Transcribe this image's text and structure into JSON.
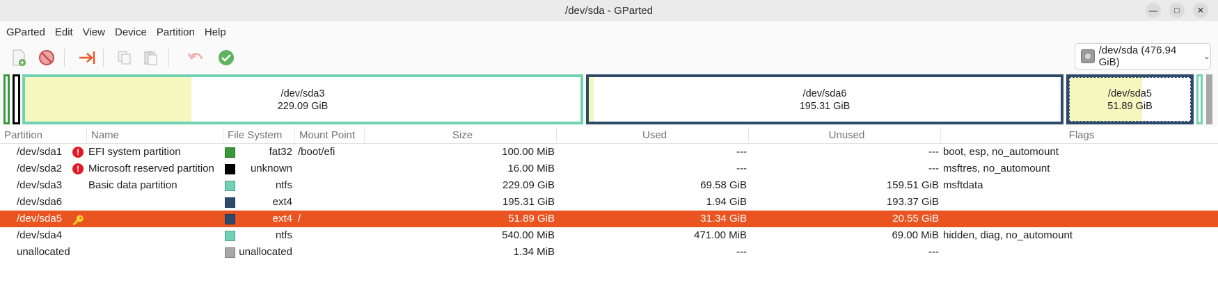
{
  "window": {
    "title": "/dev/sda - GParted"
  },
  "menu": [
    "GParted",
    "Edit",
    "View",
    "Device",
    "Partition",
    "Help"
  ],
  "toolbar": {
    "icons": [
      "new-partition-icon",
      "delete-icon",
      "resize-move-icon",
      "copy-icon",
      "paste-icon",
      "undo-icon",
      "apply-icon"
    ]
  },
  "device": {
    "label": "/dev/sda (476.94 GiB)"
  },
  "diskmap": {
    "sda3": {
      "name": "/dev/sda3",
      "size": "229.09 GiB",
      "used_fraction": 0.3
    },
    "sda6": {
      "name": "/dev/sda6",
      "size": "195.31 GiB",
      "used_fraction": 0.01
    },
    "sda5": {
      "name": "/dev/sda5",
      "size": "51.89 GiB",
      "used_fraction": 0.6
    }
  },
  "columns": [
    "Partition",
    "Name",
    "File System",
    "Mount Point",
    "Size",
    "Used",
    "Unused",
    "Flags"
  ],
  "rows": [
    {
      "partition": "/dev/sda1",
      "warning": true,
      "name": "EFI system partition",
      "fs": "fat32",
      "fs_color": "#3a9a3a",
      "mount": "/boot/efi",
      "size": "100.00 MiB",
      "used": "---",
      "unused": "---",
      "flags": "boot, esp, no_automount"
    },
    {
      "partition": "/dev/sda2",
      "warning": true,
      "name": "Microsoft reserved partition",
      "fs": "unknown",
      "fs_color": "#000000",
      "mount": "",
      "size": "16.00 MiB",
      "used": "---",
      "unused": "---",
      "flags": "msftres, no_automount"
    },
    {
      "partition": "/dev/sda3",
      "warning": false,
      "name": "Basic data partition",
      "fs": "ntfs",
      "fs_color": "#70d2b2",
      "mount": "",
      "size": "229.09 GiB",
      "used": "69.58 GiB",
      "unused": "159.51 GiB",
      "flags": "msftdata"
    },
    {
      "partition": "/dev/sda6",
      "warning": false,
      "name": "",
      "fs": "ext4",
      "fs_color": "#2e4a6b",
      "mount": "",
      "size": "195.31 GiB",
      "used": "1.94 GiB",
      "unused": "193.37 GiB",
      "flags": ""
    },
    {
      "partition": "/dev/sda5",
      "warning": false,
      "mounted": true,
      "name": "",
      "fs": "ext4",
      "fs_color": "#2e4a6b",
      "mount": "/",
      "size": "51.89 GiB",
      "used": "31.34 GiB",
      "unused": "20.55 GiB",
      "flags": "",
      "selected": true
    },
    {
      "partition": "/dev/sda4",
      "warning": false,
      "name": "",
      "fs": "ntfs",
      "fs_color": "#70d2b2",
      "mount": "",
      "size": "540.00 MiB",
      "used": "471.00 MiB",
      "unused": "69.00 MiB",
      "flags": "hidden, diag, no_automount"
    },
    {
      "partition": "unallocated",
      "warning": false,
      "name": "",
      "fs": "unallocated",
      "fs_color": "#a8a8a8",
      "mount": "",
      "size": "1.34 MiB",
      "used": "---",
      "unused": "---",
      "flags": ""
    }
  ]
}
